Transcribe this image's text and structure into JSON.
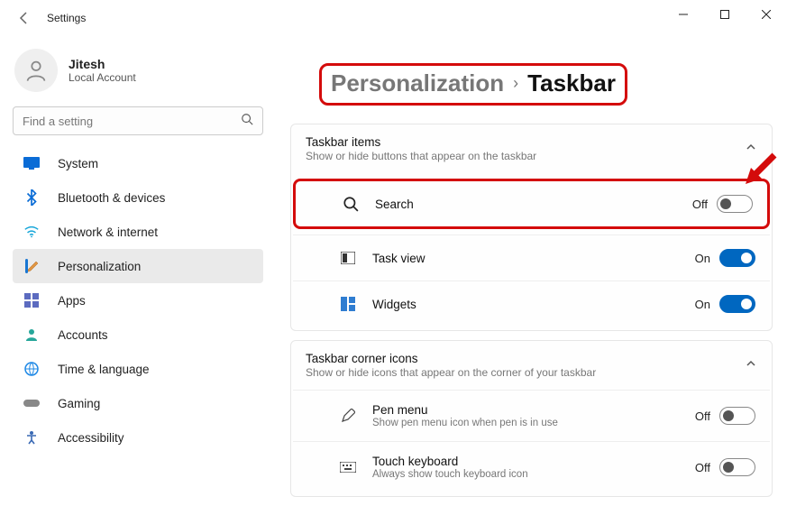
{
  "titlebar": {
    "label": "Settings"
  },
  "profile": {
    "name": "Jitesh",
    "sub": "Local Account"
  },
  "search": {
    "placeholder": "Find a setting"
  },
  "nav": {
    "system": "System",
    "bluetooth": "Bluetooth & devices",
    "network": "Network & internet",
    "personalization": "Personalization",
    "apps": "Apps",
    "accounts": "Accounts",
    "time": "Time & language",
    "gaming": "Gaming",
    "accessibility": "Accessibility"
  },
  "breadcrumb": {
    "parent": "Personalization",
    "current": "Taskbar"
  },
  "sections": {
    "items": {
      "title": "Taskbar items",
      "desc": "Show or hide buttons that appear on the taskbar",
      "search": {
        "label": "Search",
        "state": "Off"
      },
      "taskview": {
        "label": "Task view",
        "state": "On"
      },
      "widgets": {
        "label": "Widgets",
        "state": "On"
      }
    },
    "corner": {
      "title": "Taskbar corner icons",
      "desc": "Show or hide icons that appear on the corner of your taskbar",
      "pen": {
        "label": "Pen menu",
        "desc": "Show pen menu icon when pen is in use",
        "state": "Off"
      },
      "touch": {
        "label": "Touch keyboard",
        "desc": "Always show touch keyboard icon",
        "state": "Off"
      }
    }
  }
}
